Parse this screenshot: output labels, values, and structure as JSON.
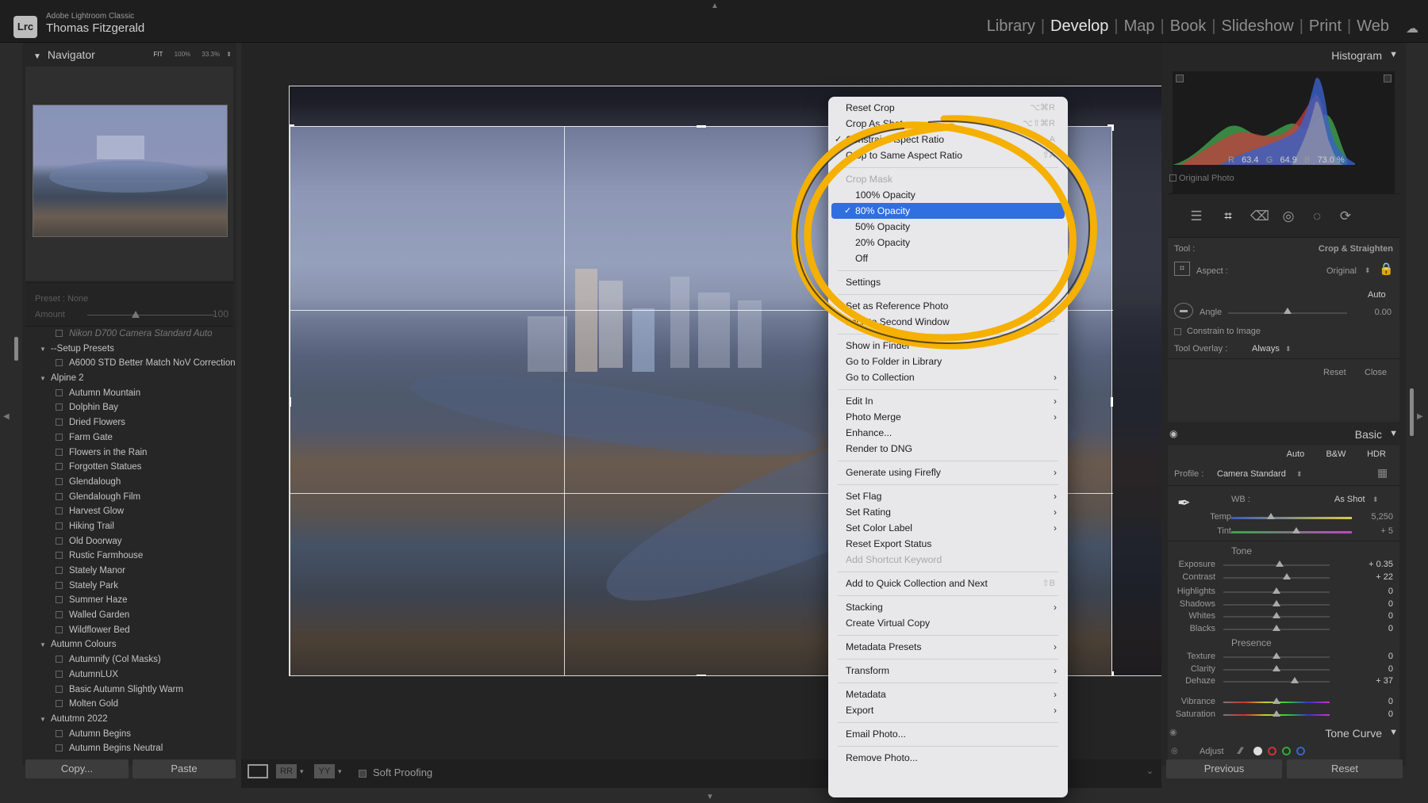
{
  "app": {
    "logo": "Lrc",
    "name": "Adobe Lightroom Classic",
    "user": "Thomas Fitzgerald",
    "modules": [
      "Library",
      "Develop",
      "Map",
      "Book",
      "Slideshow",
      "Print",
      "Web"
    ],
    "active_module": "Develop",
    "cloud_icon": "cloud-icon"
  },
  "navigator": {
    "title": "Navigator",
    "zoom_options": [
      "FIT",
      "100%",
      "33.3%"
    ]
  },
  "preset_box": {
    "preset_label": "Preset : None",
    "amount_label": "Amount",
    "amount_value": "100"
  },
  "preset_list": [
    {
      "type": "item",
      "label": "Nikon D700 Camera Standard Auto",
      "faded": true
    },
    {
      "type": "folder",
      "label": "--Setup Presets"
    },
    {
      "type": "item",
      "label": "A6000 STD Better Match NoV Correction"
    },
    {
      "type": "folder",
      "label": "Alpine 2"
    },
    {
      "type": "item",
      "label": "Autumn Mountain"
    },
    {
      "type": "item",
      "label": "Dolphin Bay"
    },
    {
      "type": "item",
      "label": "Dried Flowers"
    },
    {
      "type": "item",
      "label": "Farm Gate"
    },
    {
      "type": "item",
      "label": "Flowers in the Rain"
    },
    {
      "type": "item",
      "label": "Forgotten Statues"
    },
    {
      "type": "item",
      "label": "Glendalough"
    },
    {
      "type": "item",
      "label": "Glendalough Film"
    },
    {
      "type": "item",
      "label": "Harvest Glow"
    },
    {
      "type": "item",
      "label": "Hiking Trail"
    },
    {
      "type": "item",
      "label": "Old Doorway"
    },
    {
      "type": "item",
      "label": "Rustic Farmhouse"
    },
    {
      "type": "item",
      "label": "Stately Manor"
    },
    {
      "type": "item",
      "label": "Stately Park"
    },
    {
      "type": "item",
      "label": "Summer Haze"
    },
    {
      "type": "item",
      "label": "Walled Garden"
    },
    {
      "type": "item",
      "label": "Wildflower Bed"
    },
    {
      "type": "folder",
      "label": "Autumn Colours"
    },
    {
      "type": "item",
      "label": "Autumnify (Col Masks)"
    },
    {
      "type": "item",
      "label": "AutumnLUX"
    },
    {
      "type": "item",
      "label": "Basic Autumn Slightly Warm"
    },
    {
      "type": "item",
      "label": "Molten Gold"
    },
    {
      "type": "folder",
      "label": "Aututmn 2022"
    },
    {
      "type": "item",
      "label": "Autumn Begins"
    },
    {
      "type": "item",
      "label": "Autumn Begins Neutral"
    }
  ],
  "left_buttons": {
    "copy": "Copy...",
    "paste": "Paste"
  },
  "toolbar": {
    "rr": "RR",
    "yy": "YY",
    "soft_proofing": "Soft Proofing"
  },
  "histogram": {
    "title": "Histogram",
    "r_label": "R",
    "r_value": "63.4",
    "g_label": "G",
    "g_value": "64.9",
    "b_label": "B",
    "b_value": "73.0",
    "unit": "%",
    "original_photo": "Original Photo"
  },
  "crop_panel": {
    "tool_label": "Tool :",
    "tool_value": "Crop & Straighten",
    "aspect_label": "Aspect :",
    "aspect_value": "Original",
    "auto": "Auto",
    "angle_label": "Angle",
    "angle_value": "0.00",
    "constrain": "Constrain to Image",
    "overlay_label": "Tool Overlay :",
    "overlay_value": "Always",
    "reset": "Reset",
    "close": "Close"
  },
  "basic": {
    "title": "Basic",
    "auto": "Auto",
    "bw": "B&W",
    "hdr": "HDR",
    "profile_label": "Profile :",
    "profile_value": "Camera Standard",
    "wb_label": "WB :",
    "wb_value": "As Shot",
    "temp_label": "Temp",
    "temp_value": "5,250",
    "tint_label": "Tint",
    "tint_value": "+ 5",
    "tone_title": "Tone",
    "presence_title": "Presence",
    "sliders": [
      {
        "label": "Exposure",
        "value": "+ 0.35",
        "pos": 0.53
      },
      {
        "label": "Contrast",
        "value": "+ 22",
        "pos": 0.6
      },
      {
        "label": "Highlights",
        "value": "0",
        "pos": 0.5
      },
      {
        "label": "Shadows",
        "value": "0",
        "pos": 0.5
      },
      {
        "label": "Whites",
        "value": "0",
        "pos": 0.5
      },
      {
        "label": "Blacks",
        "value": "0",
        "pos": 0.5
      },
      {
        "label": "Texture",
        "value": "0",
        "pos": 0.5
      },
      {
        "label": "Clarity",
        "value": "0",
        "pos": 0.5
      },
      {
        "label": "Dehaze",
        "value": "+ 37",
        "pos": 0.67
      },
      {
        "label": "Vibrance",
        "value": "0",
        "pos": 0.5
      },
      {
        "label": "Saturation",
        "value": "0",
        "pos": 0.5
      }
    ],
    "tone_curve": "Tone Curve",
    "adjust": "Adjust"
  },
  "right_buttons": {
    "previous": "Previous",
    "reset": "Reset"
  },
  "context_menu": {
    "reset_crop": {
      "label": "Reset Crop",
      "shortcut": "⌥⌘R"
    },
    "crop_as_shot": {
      "label": "Crop As Shot",
      "shortcut": "⌥⇧⌘R"
    },
    "constrain_aspect": {
      "label": "Constrain Aspect Ratio",
      "shortcut": "A"
    },
    "crop_same": {
      "label": "Crop to Same Aspect Ratio",
      "shortcut": "⇧A"
    },
    "crop_mask_header": "Crop Mask",
    "opacity_options": [
      "100% Opacity",
      "80% Opacity",
      "50% Opacity",
      "20% Opacity",
      "Off"
    ],
    "selected_opacity": "80% Opacity",
    "settings": "Settings",
    "set_reference": "Set as Reference Photo",
    "lock_reference": {
      "label": "Lock to Second Window",
      "shortcut": "⇧⌘↩"
    },
    "group_a": [
      "Show in Finder",
      "Go to Folder in Library",
      "Go to Collection"
    ],
    "group_b": [
      "Edit In",
      "Photo Merge",
      "Enhance...",
      "Render to DNG"
    ],
    "generate": "Generate using Firefly",
    "group_c": [
      "Set Flag",
      "Set Rating",
      "Set Color Label",
      "Reset Export Status"
    ],
    "add_shortcut_keyword": "Add Shortcut Keyword",
    "quick_collection": {
      "label": "Add to Quick Collection and Next",
      "shortcut": "⇧B"
    },
    "stacking": "Stacking",
    "virtual_copy": "Create Virtual Copy",
    "metadata_presets": "Metadata Presets",
    "transform": "Transform",
    "metadata": "Metadata",
    "export": "Export",
    "email": "Email Photo...",
    "remove": "Remove Photo..."
  },
  "colors": {
    "highlight_ring": "#f5b000",
    "menu_selection": "#2f6fe0"
  }
}
